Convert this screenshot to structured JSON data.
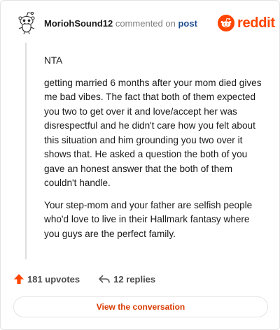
{
  "comment": {
    "username": "MoriohSound12",
    "action_text": "commented on",
    "post_link": "post",
    "paragraphs": [
      "NTA",
      "getting married 6 months after your mom died gives me bad vibes. The fact that both of them expected you two to get over it and love/accept her was disrespectful and he didn't care how you felt about this situation and him grounding you two over it shows that. He asked a question the both of you gave an honest answer that the both of them couldn't handle.",
      "Your step-mom and your father are selfish people who'd love to live in their Hallmark fantasy where you guys are the perfect family."
    ]
  },
  "brand": {
    "wordmark": "reddit",
    "icon": "reddit-alien-icon",
    "color": "#ff4500"
  },
  "footer": {
    "upvotes_label": "181 upvotes",
    "upvote_icon": "upvote-arrow-icon",
    "upvote_color": "#ff4500",
    "replies_label": "12 replies",
    "reply_icon": "reply-arrow-icon"
  },
  "actions": {
    "view_conversation_label": "View the conversation",
    "accent": "#d93a00"
  },
  "avatar": {
    "icon": "snoo-avatar-icon"
  }
}
